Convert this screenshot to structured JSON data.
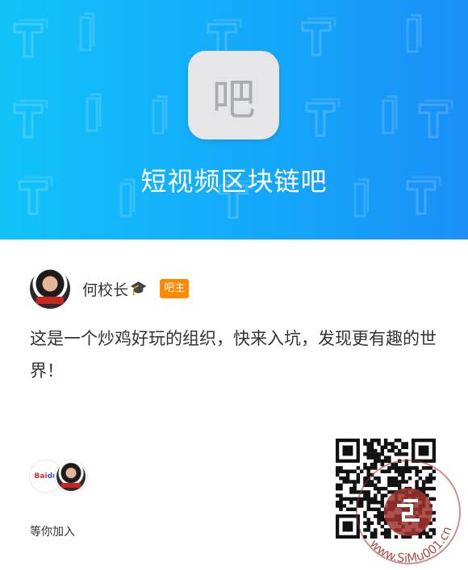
{
  "forum": {
    "logo_char": "吧",
    "title": "短视频区块链吧"
  },
  "owner": {
    "name": "何校长",
    "badge": "吧主"
  },
  "description": "这是一个炒鸡好玩的组织，快来入坑，发现更有趣的世界！",
  "members": {
    "waiting_text": "等你加入"
  },
  "watermark": {
    "text": "www.SiMu001.cn"
  },
  "icons": {
    "cap": "graduation-cap-icon",
    "pattern": "t-letter-pattern",
    "qr": "qr-code-icon"
  },
  "colors": {
    "header_start": "#12c3f9",
    "header_end": "#1a8ff7",
    "badge": "#ff8a00",
    "text": "#333333",
    "watermark": "#a0312c"
  }
}
